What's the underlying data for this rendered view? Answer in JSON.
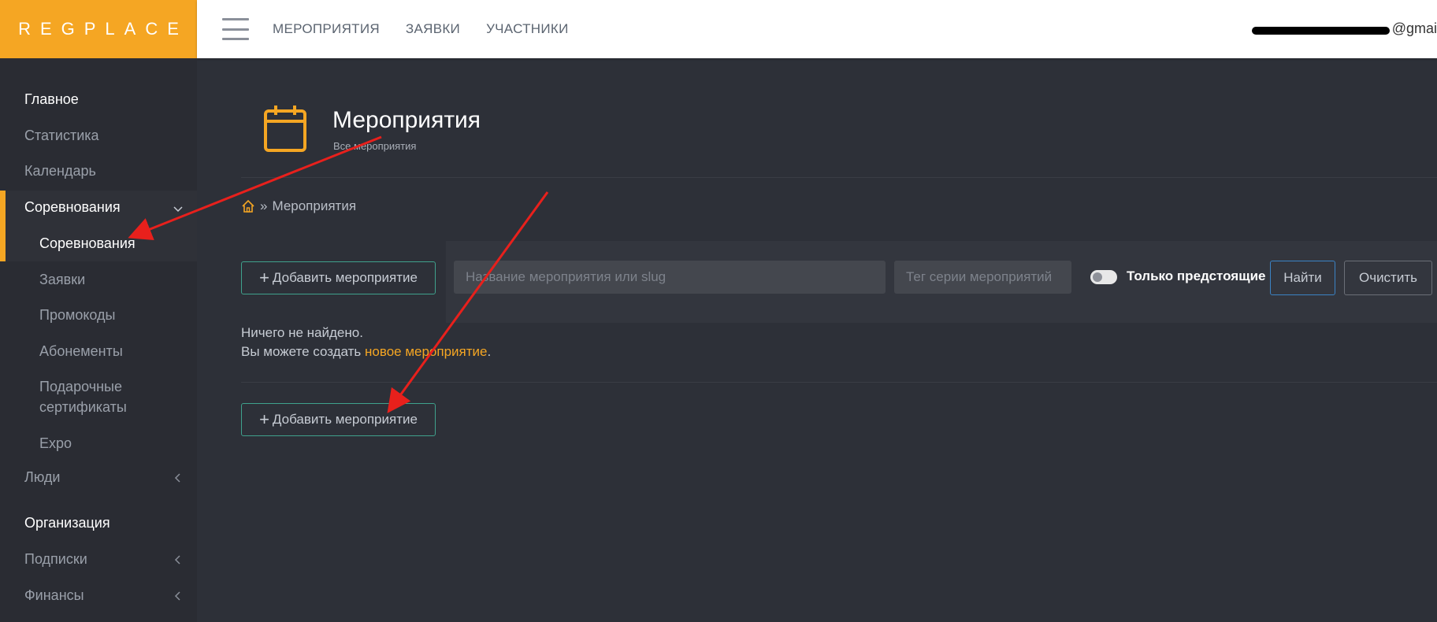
{
  "brand": {
    "logo": "REGPLACE",
    "color": "#f5a623"
  },
  "topnav": [
    "МЕРОПРИЯТИЯ",
    "ЗАЯВКИ",
    "УЧАСТНИКИ"
  ],
  "user": {
    "email_visible": "@gmai"
  },
  "sidebar": {
    "section_main": "Главное",
    "items": {
      "stats": "Статистика",
      "calendar": "Календарь",
      "competitions": "Соревнования",
      "people": "Люди"
    },
    "sub": {
      "competitions": "Соревнования",
      "applications": "Заявки",
      "promocodes": "Промокоды",
      "subscriptions_pass": "Абонементы",
      "gift_line1": "Подарочные",
      "gift_line2": "сертификаты",
      "expo": "Expo"
    },
    "section_org": "Организация",
    "org_items": {
      "subscriptions": "Подписки",
      "finance": "Финансы"
    }
  },
  "page": {
    "title": "Мероприятия",
    "subtitle": "Все мероприятия",
    "breadcrumb_sep": "»",
    "breadcrumb_current": "Мероприятия"
  },
  "actions": {
    "add_event": "Добавить мероприятие",
    "plus": "+"
  },
  "filters": {
    "name_placeholder": "Название мероприятия или slug",
    "tag_placeholder": "Тег серии мероприятий",
    "upcoming_only": "Только предстоящие",
    "upcoming_only_on": false,
    "find": "Найти",
    "clear": "Очистить"
  },
  "empty": {
    "line1": "Ничего не найдено.",
    "line2_prefix": "Вы можете создать ",
    "line2_link": "новое мероприятие",
    "line2_suffix": "."
  },
  "annotation": {
    "arrow_color": "#e8201c"
  }
}
